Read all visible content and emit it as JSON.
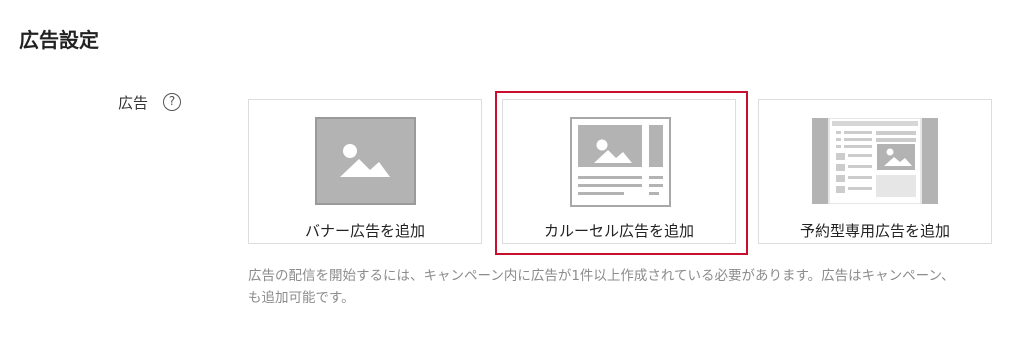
{
  "section": {
    "title": "広告設定"
  },
  "ads_field": {
    "label": "広告",
    "help_icon": "?"
  },
  "ad_options": [
    {
      "label": "バナー広告を追加",
      "icon": "image-placeholder-icon",
      "selected": false
    },
    {
      "label": "カルーセル広告を追加",
      "icon": "carousel-layout-icon",
      "selected": true
    },
    {
      "label": "予約型専用広告を追加",
      "icon": "reserved-layout-icon",
      "selected": false
    }
  ],
  "note": {
    "line1": "広告の配信を開始するには、キャンペーン内に広告が1件以上作成されている必要があります。広告はキャンペーン、",
    "line2": "も追加可能です。"
  },
  "colors": {
    "selected_border": "#c8102e",
    "placeholder_gray": "#b3b3b3",
    "note_text": "#8c8c8c"
  }
}
